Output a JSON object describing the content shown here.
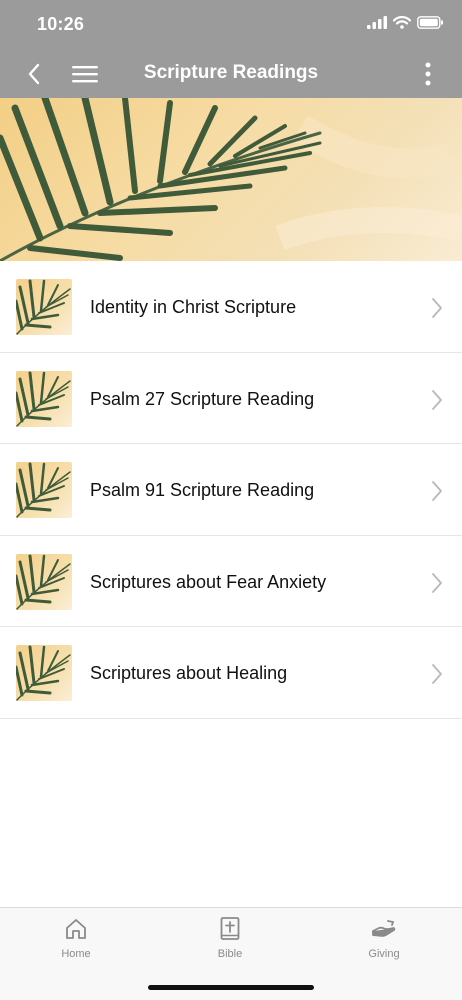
{
  "status_bar": {
    "time": "10:26"
  },
  "nav": {
    "title": "Scripture Readings"
  },
  "items": [
    {
      "label": "Identity in Christ Scripture"
    },
    {
      "label": "Psalm 27 Scripture Reading"
    },
    {
      "label": "Psalm 91 Scripture Reading"
    },
    {
      "label": "Scriptures about Fear Anxiety"
    },
    {
      "label": "Scriptures about Healing"
    }
  ],
  "tabs": [
    {
      "label": "Home",
      "icon": "home-icon"
    },
    {
      "label": "Bible",
      "icon": "bible-icon"
    },
    {
      "label": "Giving",
      "icon": "giving-hand-icon"
    }
  ],
  "colors": {
    "header": "#9b9b9b",
    "hero_background": "#f4d79d",
    "leaf": "#3f5b3a"
  }
}
